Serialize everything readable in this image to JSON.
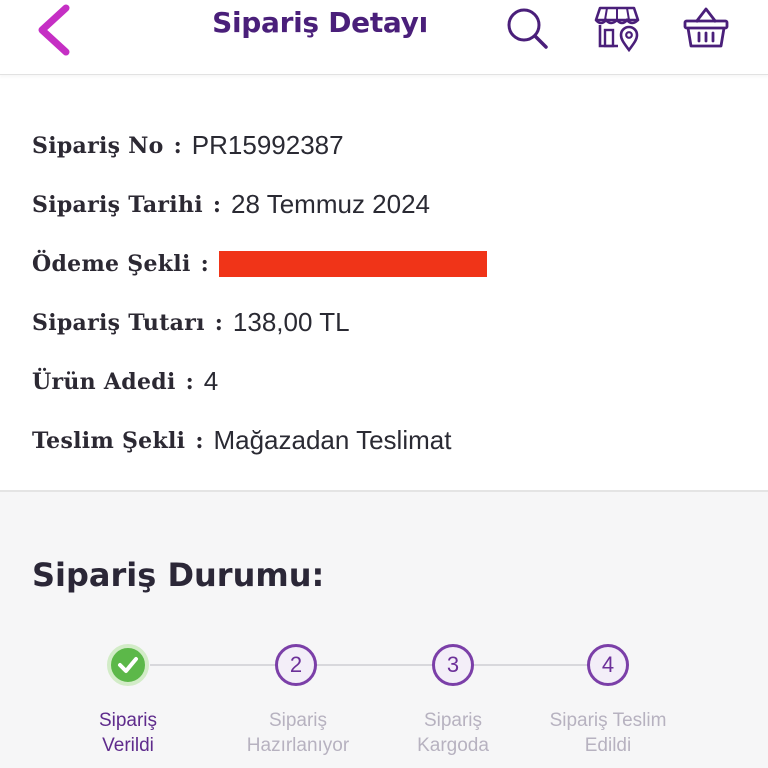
{
  "header": {
    "title": "Sipariş Detayı",
    "back_icon": "chevron-left-icon",
    "search_icon": "search-icon",
    "store_icon": "store-location-icon",
    "basket_icon": "basket-icon"
  },
  "order_info": {
    "order_no_label": "Sipariş No",
    "order_no_value": "PR15992387",
    "order_date_label": "Sipariş Tarihi",
    "order_date_value": "28 Temmuz 2024",
    "payment_label": "Ödeme Şekli",
    "payment_value_redacted": true,
    "amount_label": "Sipariş Tutarı",
    "amount_value": "138,00 TL",
    "item_count_label": "Ürün Adedi",
    "item_count_value": "4",
    "delivery_label": "Teslim Şekli",
    "delivery_value": "Mağazadan Teslimat",
    "separator": ":"
  },
  "status": {
    "title": "Sipariş Durumu:",
    "current_step": 1,
    "steps": [
      {
        "number": "1",
        "label": "Sipariş\nVerildi",
        "state": "done"
      },
      {
        "number": "2",
        "label": "Sipariş\nHazırlanıyor",
        "state": "pending"
      },
      {
        "number": "3",
        "label": "Sipariş\nKargoda",
        "state": "pending"
      },
      {
        "number": "4",
        "label": "Sipariş Teslim\nEdildi",
        "state": "pending"
      }
    ]
  },
  "colors": {
    "brand_purple": "#4a1f7a",
    "accent_magenta": "#c52fc4",
    "success_green": "#5cb849",
    "redaction_red": "#f03418"
  }
}
